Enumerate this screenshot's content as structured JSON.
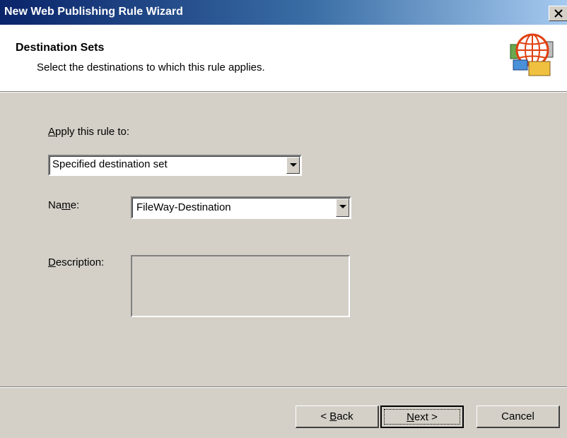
{
  "window": {
    "title": "New Web Publishing Rule Wizard",
    "close_label": "×"
  },
  "header": {
    "title": "Destination Sets",
    "subtitle": "Select the destinations to which this rule applies.",
    "icon": "globe-wizard-icon"
  },
  "form": {
    "apply_label_accel": "A",
    "apply_label_rest": "pply this rule to:",
    "apply_value": "Specified destination set",
    "name_label_pre": "Na",
    "name_label_accel": "m",
    "name_label_post": "e:",
    "name_value": "FileWay-Destination",
    "description_label_accel": "D",
    "description_label_rest": "escription:",
    "description_value": ""
  },
  "buttons": {
    "back_pre": "< ",
    "back_accel": "B",
    "back_post": "ack",
    "next_accel": "N",
    "next_post": "ext >",
    "cancel": "Cancel"
  },
  "colors": {
    "titlebar_start": "#0a246a",
    "titlebar_end": "#a6caf0",
    "dialog_bg": "#d4d0c8",
    "header_bg": "#ffffff"
  }
}
